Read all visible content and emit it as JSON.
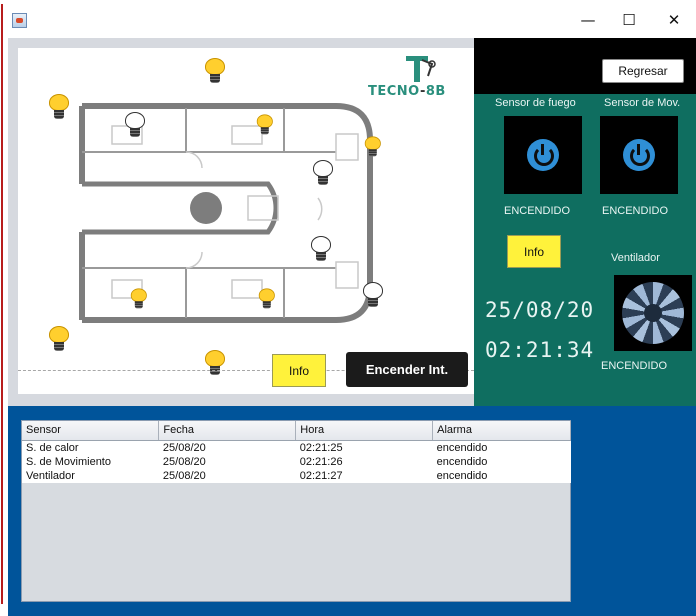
{
  "window": {
    "minimize_glyph": "—",
    "maximize_glyph": "☐",
    "close_glyph": "✕"
  },
  "map": {
    "logo_text": "TECNO-8B",
    "info_button": "Info",
    "encender_button": "Encender Int."
  },
  "controls": {
    "regresar_button": "Regresar",
    "sensor_fuego_label": "Sensor de fuego",
    "sensor_mov_label": "Sensor de Mov.",
    "fuego_status": "ENCENDIDO",
    "mov_status": "ENCENDIDO",
    "info_button": "Info",
    "ventilador_label": "Ventilador",
    "date": "25/08/20",
    "time": "02:21:34",
    "ventilador_status": "ENCENDIDO"
  },
  "table": {
    "headers": [
      "Sensor",
      "Fecha",
      "Hora",
      "Alarma"
    ],
    "rows": [
      [
        "S. de calor",
        "25/08/20",
        "02:21:25",
        "encendido"
      ],
      [
        "S. de Movimiento",
        "25/08/20",
        "02:21:26",
        "encendido"
      ],
      [
        "Ventilador",
        "25/08/20",
        "02:21:27",
        "encendido"
      ]
    ]
  },
  "colors": {
    "panel_teal": "#0f6e60",
    "background_blue": "#00549a",
    "bulb_on": "#ffcf2e",
    "info_yellow": "#fff23b",
    "power_blue": "#2f8fd6"
  },
  "icons": {
    "app": "java-app-icon",
    "bulb_on": "lightbulb-on-icon",
    "bulb_off": "lightbulb-off-icon",
    "power": "power-icon",
    "fan": "fan-icon"
  }
}
